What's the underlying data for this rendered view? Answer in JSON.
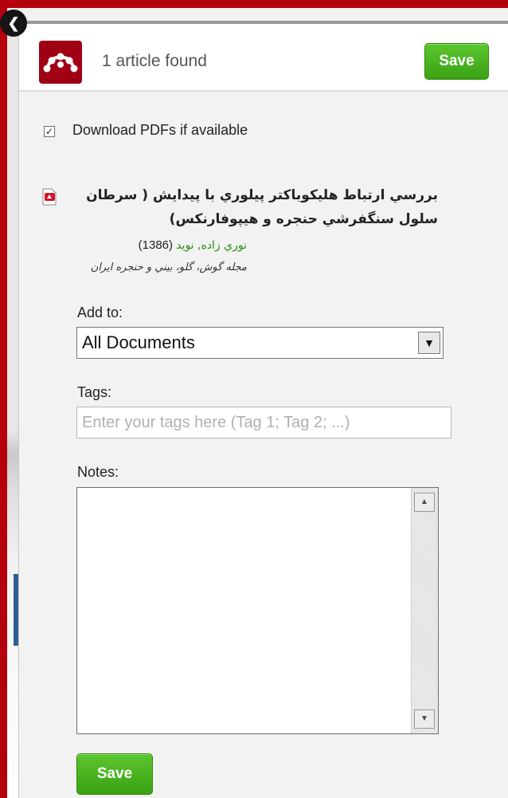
{
  "header": {
    "found_text": "1 article found",
    "save_label": "Save",
    "close_symbol": "❮"
  },
  "options": {
    "download_pdfs_label": "Download PDFs if available",
    "download_pdfs_checked": true
  },
  "article": {
    "title": "بررسي ارتباط هليكوباكتر پيلوري با پيدايش ( سرطان سلول سنگفرشي حنجره و هيپوفارنكس)",
    "authors": "نوري زاده, نويد",
    "year": "(1386)",
    "journal": "مجله گوش، گلو، بيني و حنجره ايران",
    "icon": "pdf-icon"
  },
  "form": {
    "add_to_label": "Add to:",
    "add_to_value": "All Documents",
    "tags_label": "Tags:",
    "tags_placeholder": "Enter your tags here (Tag 1; Tag 2; ...)",
    "notes_label": "Notes:",
    "notes_value": ""
  },
  "footer": {
    "save_label": "Save"
  },
  "colors": {
    "brand": "#a00014",
    "save_green": "#3aa114",
    "author_green": "#2a8c12"
  }
}
